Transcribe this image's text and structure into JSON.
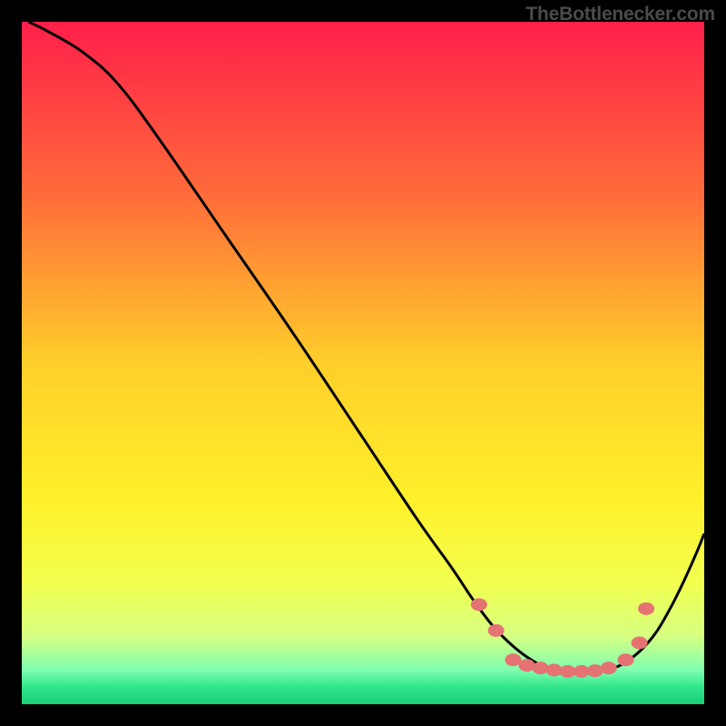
{
  "watermark": "TheBottlenecker.com",
  "colors": {
    "gradient_stops": [
      {
        "offset": 0,
        "color": "#ff1f4a"
      },
      {
        "offset": 0.25,
        "color": "#ff6a3a"
      },
      {
        "offset": 0.5,
        "color": "#ffcf2a"
      },
      {
        "offset": 0.7,
        "color": "#fff02a"
      },
      {
        "offset": 0.82,
        "color": "#f2ff4e"
      },
      {
        "offset": 0.9,
        "color": "#d7ff82"
      },
      {
        "offset": 0.95,
        "color": "#7fffb0"
      },
      {
        "offset": 0.975,
        "color": "#30e58a"
      },
      {
        "offset": 1.0,
        "color": "#18cf77"
      }
    ],
    "curve": "#000000",
    "marker": "#e57373"
  },
  "chart_data": {
    "type": "line",
    "title": "",
    "xlabel": "",
    "ylabel": "",
    "xlim": [
      0,
      100
    ],
    "ylim": [
      0,
      100
    ],
    "curve": [
      {
        "x": 1,
        "y": 100
      },
      {
        "x": 4,
        "y": 98.5
      },
      {
        "x": 9,
        "y": 95.5
      },
      {
        "x": 14,
        "y": 91
      },
      {
        "x": 20,
        "y": 83
      },
      {
        "x": 30,
        "y": 68.5
      },
      {
        "x": 40,
        "y": 54
      },
      {
        "x": 50,
        "y": 39
      },
      {
        "x": 58,
        "y": 27
      },
      {
        "x": 63,
        "y": 20
      },
      {
        "x": 66,
        "y": 15.5
      },
      {
        "x": 69,
        "y": 11.5
      },
      {
        "x": 72,
        "y": 8.5
      },
      {
        "x": 75,
        "y": 6.3
      },
      {
        "x": 78,
        "y": 5.0
      },
      {
        "x": 81,
        "y": 4.5
      },
      {
        "x": 84,
        "y": 4.6
      },
      {
        "x": 87,
        "y": 5.4
      },
      {
        "x": 89,
        "y": 6.5
      },
      {
        "x": 91,
        "y": 8.2
      },
      {
        "x": 93,
        "y": 10.6
      },
      {
        "x": 95,
        "y": 14
      },
      {
        "x": 97,
        "y": 18
      },
      {
        "x": 99,
        "y": 22.5
      },
      {
        "x": 100,
        "y": 25
      }
    ],
    "markers": [
      {
        "x": 67,
        "y": 14.6
      },
      {
        "x": 69.5,
        "y": 10.8
      },
      {
        "x": 72,
        "y": 6.5
      },
      {
        "x": 74,
        "y": 5.7
      },
      {
        "x": 76,
        "y": 5.3
      },
      {
        "x": 78,
        "y": 5.0
      },
      {
        "x": 80,
        "y": 4.8
      },
      {
        "x": 82,
        "y": 4.8
      },
      {
        "x": 84,
        "y": 4.9
      },
      {
        "x": 86,
        "y": 5.3
      },
      {
        "x": 88.5,
        "y": 6.5
      },
      {
        "x": 90.5,
        "y": 9.0
      },
      {
        "x": 91.5,
        "y": 14.0
      }
    ]
  }
}
